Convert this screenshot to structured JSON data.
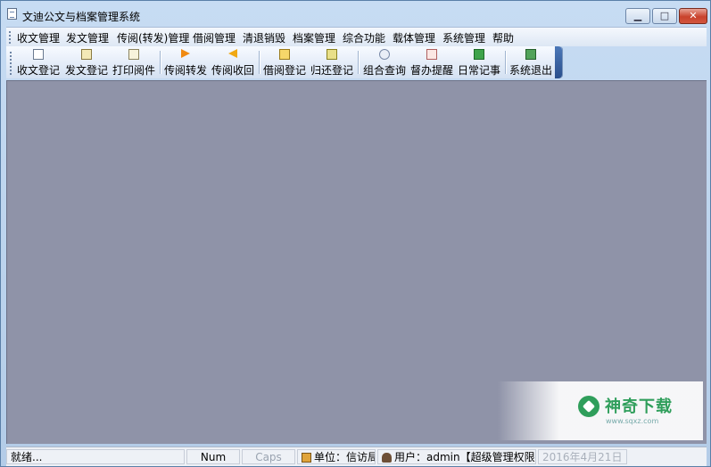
{
  "window": {
    "title": "文迪公文与档案管理系统",
    "controls": {
      "minimize": "▁",
      "maximize": "□",
      "close": "✕"
    }
  },
  "menu": [
    {
      "label": "收文管理"
    },
    {
      "label": "发文管理"
    },
    {
      "label": "传阅(转发)管理"
    },
    {
      "label": "借阅管理"
    },
    {
      "label": "清退销毁"
    },
    {
      "label": "档案管理"
    },
    {
      "label": "综合功能"
    },
    {
      "label": "载体管理"
    },
    {
      "label": "系统管理"
    },
    {
      "label": "帮助"
    }
  ],
  "toolbar": [
    {
      "label": "收文登记",
      "icon": "doc-edit-icon"
    },
    {
      "label": "发文登记",
      "icon": "doc-send-icon"
    },
    {
      "label": "打印阅件",
      "icon": "print-doc-icon"
    },
    {
      "label": "传阅转发",
      "icon": "arrow-right-icon"
    },
    {
      "label": "传阅收回",
      "icon": "arrow-left-icon"
    },
    {
      "label": "借阅登记",
      "icon": "book-lend-icon"
    },
    {
      "label": "归还登记",
      "icon": "book-return-icon"
    },
    {
      "label": "组合查询",
      "icon": "magnifier-icon"
    },
    {
      "label": "督办提醒",
      "icon": "reminder-icon"
    },
    {
      "label": "日常记事",
      "icon": "notebook-icon"
    },
    {
      "label": "系统退出",
      "icon": "exit-door-icon"
    }
  ],
  "watermark": {
    "brand": "神奇下载",
    "url": "www.sqxz.com"
  },
  "statusbar": {
    "ready": "就绪...",
    "num": "Num",
    "caps": "Caps",
    "unit": "单位：信访局",
    "user": "用户：admin【超级管理权限】",
    "date": "2016年4月21日"
  },
  "colors": {
    "workspace": "#8f93a8",
    "accent": "#2f9e5b"
  }
}
